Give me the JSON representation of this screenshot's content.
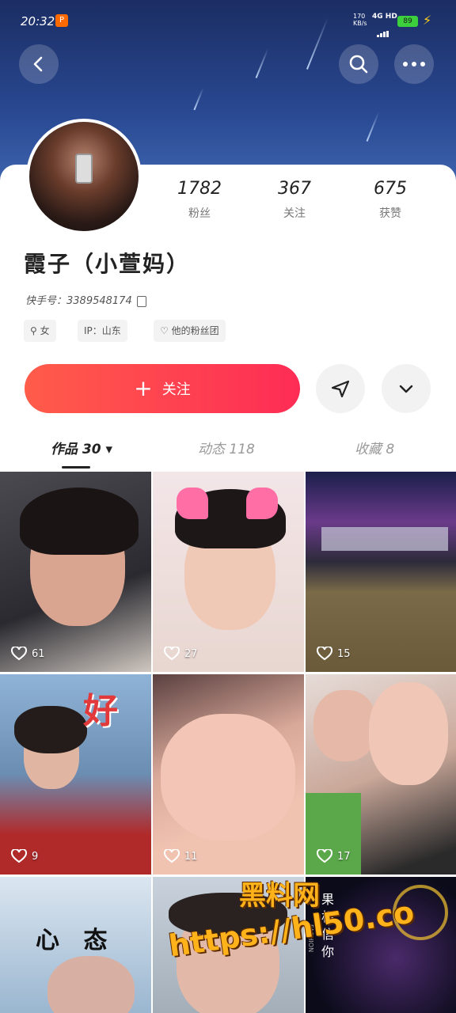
{
  "status_bar": {
    "time": "20:32",
    "app_badge": "P",
    "net_speed_top": "170",
    "net_speed_unit": "KB/s",
    "network": "4G HD",
    "battery": "89"
  },
  "header": {
    "back_icon": "back-arrow-icon",
    "search_icon": "search-icon",
    "more_icon": "more-dots-icon"
  },
  "profile": {
    "stats": [
      {
        "value": "1782",
        "label": "粉丝"
      },
      {
        "value": "367",
        "label": "关注"
      },
      {
        "value": "675",
        "label": "获赞"
      }
    ],
    "name": "霞子（小萱妈）",
    "kuaishou_id_label": "快手号：",
    "kuaishou_id": "3389548174",
    "tags": [
      "女",
      "IP：山东",
      "他的粉丝团"
    ]
  },
  "actions": {
    "follow_label": "关注",
    "follow_icon": "plus-icon",
    "share_icon": "send-icon",
    "dropdown_icon": "chevron-down-icon"
  },
  "tabs": [
    {
      "label": "作品 30 ▾",
      "active": true
    },
    {
      "label": "动态 118",
      "active": false
    },
    {
      "label": "收藏 8",
      "active": false
    }
  ],
  "videos": [
    {
      "likes": "61"
    },
    {
      "likes": "27"
    },
    {
      "likes": "15"
    },
    {
      "likes": "9"
    },
    {
      "likes": "11"
    },
    {
      "likes": "17"
    },
    {
      "likes": ""
    },
    {
      "likes": ""
    },
    {
      "likes": ""
    }
  ],
  "video_texts": {
    "cell4_text": "好",
    "cell7_text": "心 态",
    "cell9_text": "果 相信你",
    "cell9_side": "FASHION"
  },
  "watermark": {
    "line1": "黑料网",
    "line2": "https://hl50.co"
  },
  "colors": {
    "accent": "#fe2c55",
    "header_bg": "#2a4a94"
  }
}
